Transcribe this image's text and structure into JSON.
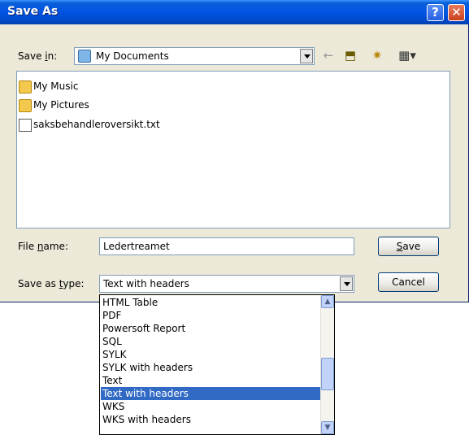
{
  "dialog": {
    "title": "Save As",
    "help_glyph": "?",
    "close_glyph": "✕"
  },
  "save_in": {
    "label_prefix": "Save ",
    "label_hotkey": "i",
    "label_suffix": "n:",
    "value": "My Documents",
    "value_icon": "folder-icon"
  },
  "toolbar": {
    "back_icon": "←",
    "up_icon": "⬒",
    "new_folder_icon": "✷",
    "views_icon": "▦▾"
  },
  "files": [
    {
      "name": "My Music",
      "icon": "folder-icon"
    },
    {
      "name": "My Pictures",
      "icon": "folder-icon"
    },
    {
      "name": "saksbehandleroversikt.txt",
      "icon": "text-file-icon"
    }
  ],
  "file_name": {
    "label_prefix": "File ",
    "label_hotkey": "n",
    "label_suffix": "ame:",
    "value": "Ledertreamet"
  },
  "save_type": {
    "label_prefix": "Save as ",
    "label_hotkey": "t",
    "label_suffix": "ype:",
    "value": "Text with headers",
    "options": [
      "HTML Table",
      "PDF",
      "Powersoft Report",
      "SQL",
      "SYLK",
      "SYLK with headers",
      "Text",
      "Text with headers",
      "WKS",
      "WKS with headers"
    ],
    "selected_index": 7
  },
  "buttons": {
    "save_hotkey": "S",
    "save_rest": "ave",
    "cancel": "Cancel"
  }
}
